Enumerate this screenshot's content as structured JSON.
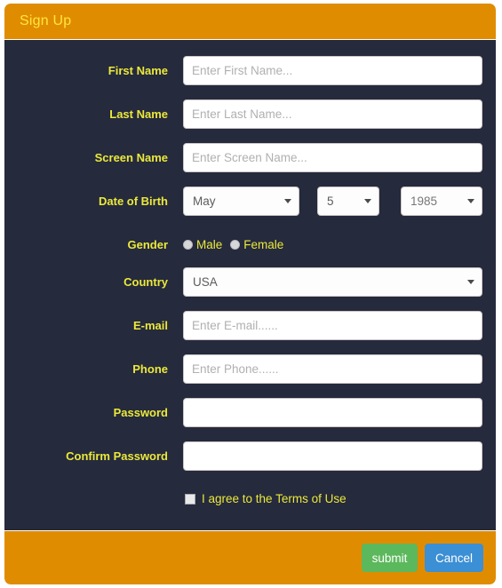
{
  "header": {
    "title": "Sign Up",
    "background": "#e08c00",
    "title_color": "#ffe53d"
  },
  "theme": {
    "body_background": "#252a3d",
    "label_color": "#ece93a",
    "accent_orange": "#e08c00",
    "submit_green": "#5cb85c",
    "cancel_blue": "#3b8fd4"
  },
  "form": {
    "fields": [
      {
        "label": "First Name",
        "placeholder": "Enter First Name...",
        "value": ""
      },
      {
        "label": "Last Name",
        "placeholder": "Enter Last Name...",
        "value": ""
      },
      {
        "label": "Screen Name",
        "placeholder": "Enter Screen Name...",
        "value": ""
      }
    ],
    "date_of_birth": {
      "label": "Date of Birth",
      "month": "May",
      "day": "5",
      "year": "1985"
    },
    "gender": {
      "label": "Gender",
      "options": [
        {
          "label": "Male",
          "selected": false
        },
        {
          "label": "Female",
          "selected": false
        }
      ]
    },
    "country": {
      "label": "Country",
      "value": "USA"
    },
    "contact": [
      {
        "label": "E-mail",
        "placeholder": "Enter E-mail......",
        "value": ""
      },
      {
        "label": "Phone",
        "placeholder": "Enter Phone......",
        "value": ""
      }
    ],
    "passwords": [
      {
        "label": "Password",
        "placeholder": "",
        "value": ""
      },
      {
        "label": "Confirm Password",
        "placeholder": "",
        "value": ""
      }
    ],
    "terms": {
      "label": "I agree to the Terms of Use",
      "checked": false
    }
  },
  "footer": {
    "submit_label": "submit",
    "cancel_label": "Cancel"
  }
}
